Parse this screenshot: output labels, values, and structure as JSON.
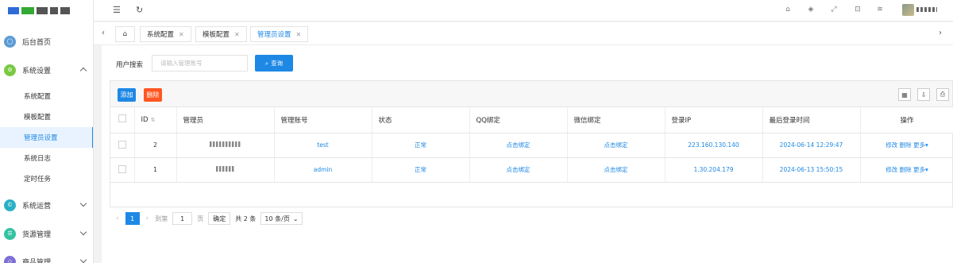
{
  "sidebar": {
    "items": [
      {
        "label": "后台首页",
        "icon": "home-icon",
        "color": "#5b9bd5"
      },
      {
        "label": "系统设置",
        "icon": "settings-icon",
        "color": "#7ac943"
      },
      {
        "label": "系统运营",
        "icon": "operations-icon",
        "color": "#2ab0c5"
      },
      {
        "label": "货源管理",
        "icon": "goods-icon",
        "color": "#33c3a0"
      },
      {
        "label": "商品管理",
        "icon": "product-icon",
        "color": "#7e6fd6"
      }
    ],
    "sub_items": [
      "系统配置",
      "模板配置",
      "管理员设置",
      "系统日志",
      "定时任务"
    ]
  },
  "tabs": [
    {
      "label": "系统配置"
    },
    {
      "label": "模板配置"
    },
    {
      "label": "管理员设置"
    }
  ],
  "search": {
    "label": "用户搜索",
    "placeholder": "请输入管理账号",
    "button": "查询"
  },
  "toolbar": {
    "add_label": "添加",
    "delete_label": "删除"
  },
  "table": {
    "headers": [
      "ID",
      "管理员",
      "管理账号",
      "状态",
      "QQ绑定",
      "微信绑定",
      "登录IP",
      "最后登录时间",
      "操作"
    ],
    "rows": [
      {
        "id": "2",
        "account": "test",
        "status": "正常",
        "qq": "点击绑定",
        "wechat": "点击绑定",
        "ip": "223.160.130.140",
        "last_login": "2024-06-14 12:29:47",
        "edit": "修改",
        "delete": "删除",
        "more": "更多"
      },
      {
        "id": "1",
        "account": "admin",
        "status": "正常",
        "qq": "点击绑定",
        "wechat": "点击绑定",
        "ip": "1.30.204.179",
        "last_login": "2024-06-13 15:50:15",
        "edit": "修改",
        "delete": "删除",
        "more": "更多"
      }
    ]
  },
  "pager": {
    "current": "1",
    "goto": "到第",
    "page_value": "1",
    "page_unit": "页",
    "confirm": "确定",
    "total": "共 2 条",
    "page_size": "10 条/页"
  },
  "colors": {
    "accent": "#1e88e5",
    "danger": "#ff5722"
  }
}
